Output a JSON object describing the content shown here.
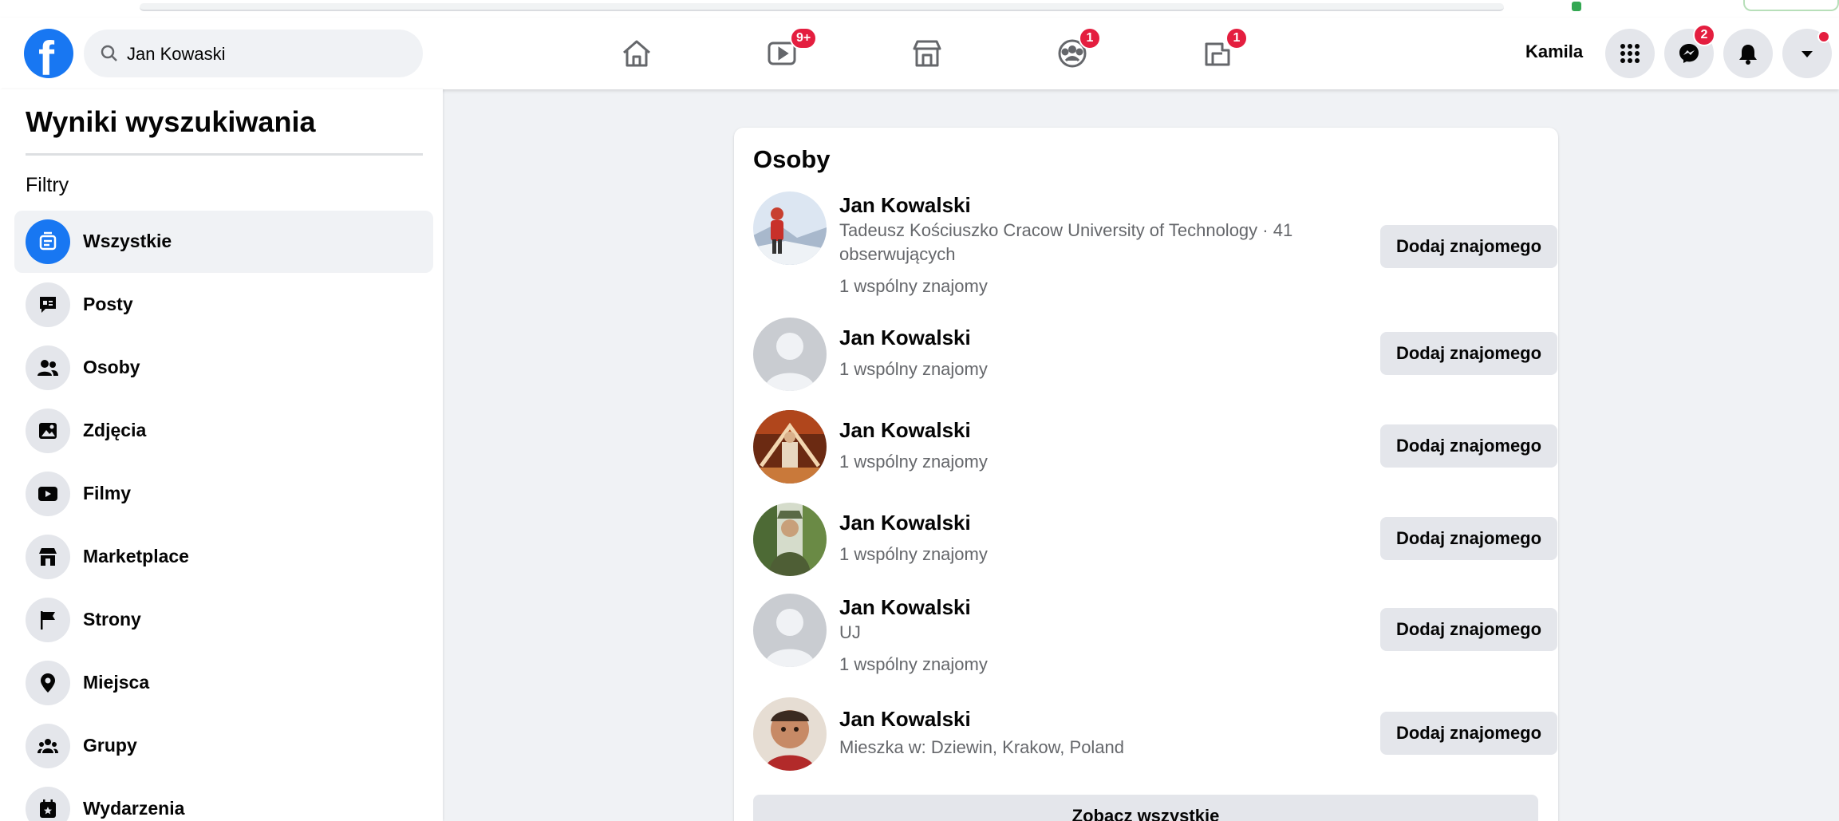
{
  "search": {
    "value": "Jan Kowaski"
  },
  "header": {
    "user_name": "Kamila",
    "badges": {
      "watch": "9+",
      "groups": "1",
      "gaming": "1",
      "messenger": "2"
    }
  },
  "sidebar": {
    "title": "Wyniki wyszukiwania",
    "filters_label": "Filtry",
    "items": [
      {
        "label": "Wszystkie",
        "icon": "feed-icon"
      },
      {
        "label": "Posty",
        "icon": "posts-icon"
      },
      {
        "label": "Osoby",
        "icon": "people-icon"
      },
      {
        "label": "Zdjęcia",
        "icon": "photos-icon"
      },
      {
        "label": "Filmy",
        "icon": "video-icon"
      },
      {
        "label": "Marketplace",
        "icon": "marketplace-icon"
      },
      {
        "label": "Strony",
        "icon": "flag-icon"
      },
      {
        "label": "Miejsca",
        "icon": "location-pin-icon"
      },
      {
        "label": "Grupy",
        "icon": "groups-icon"
      },
      {
        "label": "Wydarzenia",
        "icon": "calendar-icon"
      }
    ]
  },
  "people": {
    "title": "Osoby",
    "add_label": "Dodaj znajomego",
    "see_all": "Zobacz wszystkie",
    "results": [
      {
        "name": "Jan Kowalski",
        "line1": "Tadeusz Kościuszko Cracow University of Technology · 41",
        "line2": "obserwujących",
        "mutual": "1 wspólny znajomy"
      },
      {
        "name": "Jan Kowalski",
        "mutual": "1 wspólny znajomy"
      },
      {
        "name": "Jan Kowalski",
        "mutual": "1 wspólny znajomy"
      },
      {
        "name": "Jan Kowalski",
        "mutual": "1 wspólny znajomy"
      },
      {
        "name": "Jan Kowalski",
        "line1": "UJ",
        "mutual": "1 wspólny znajomy"
      },
      {
        "name": "Jan Kowalski",
        "line1": "Mieszka w: Dziewin, Krakow, Poland"
      }
    ]
  },
  "colors": {
    "brand": "#1877f2",
    "badge": "#e41e3f",
    "page_bg": "#f0f2f5",
    "button_bg": "#e4e6eb"
  }
}
